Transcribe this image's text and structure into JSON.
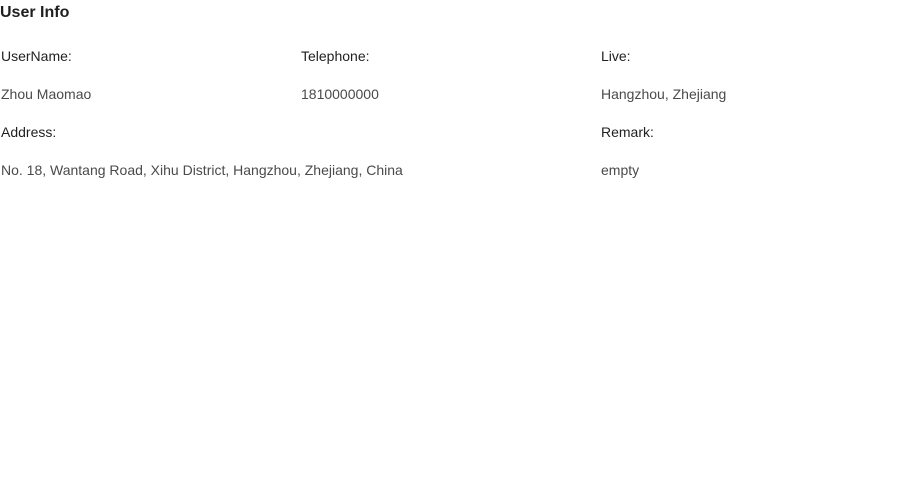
{
  "title": "User Info",
  "fields": {
    "username": {
      "label": "UserName:",
      "value": "Zhou Maomao"
    },
    "telephone": {
      "label": "Telephone:",
      "value": "1810000000"
    },
    "live": {
      "label": "Live:",
      "value": "Hangzhou, Zhejiang"
    },
    "address": {
      "label": "Address:",
      "value": "No. 18, Wantang Road, Xihu District, Hangzhou, Zhejiang, China"
    },
    "remark": {
      "label": "Remark:",
      "value": "empty"
    }
  }
}
